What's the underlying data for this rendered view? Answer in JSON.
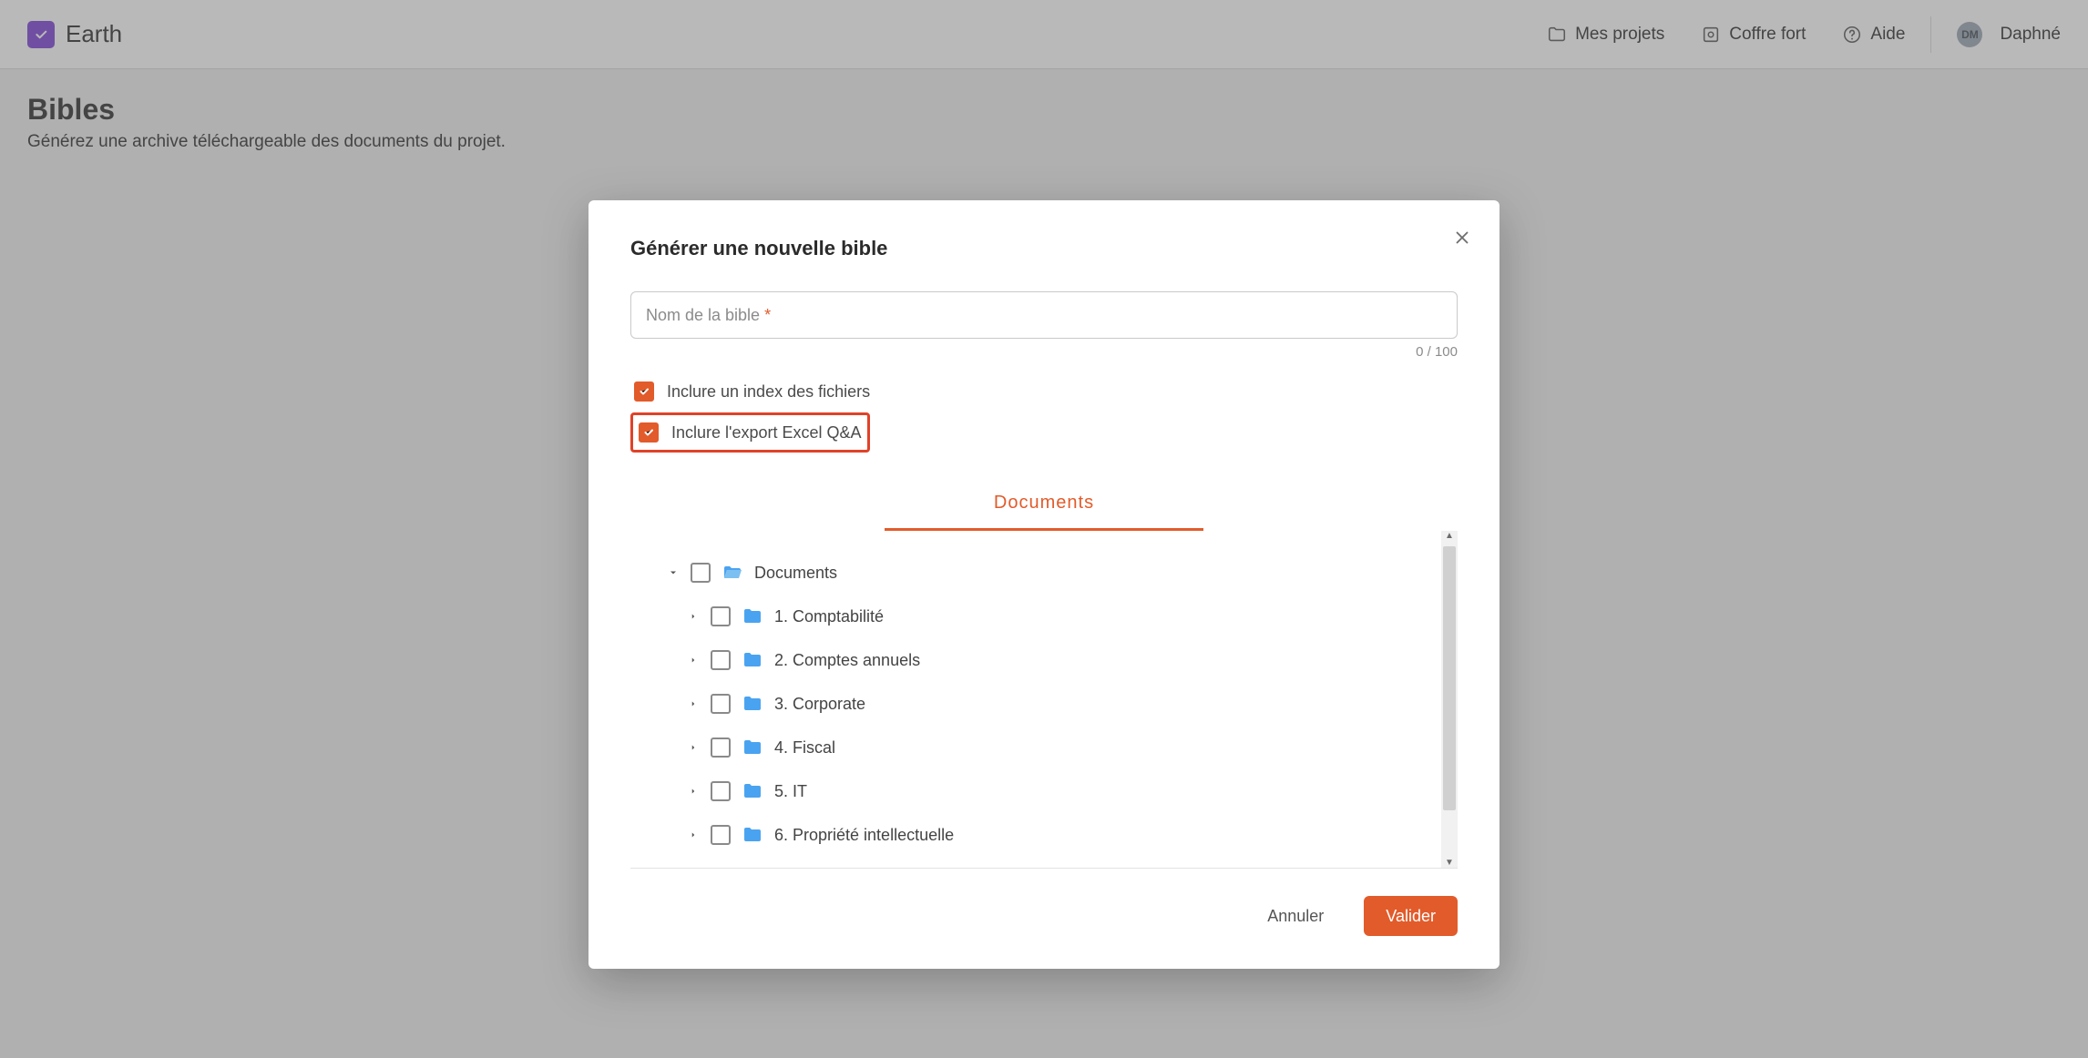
{
  "app": {
    "name": "Earth"
  },
  "header": {
    "nav": [
      {
        "icon": "folder-icon",
        "label": "Mes projets"
      },
      {
        "icon": "vault-icon",
        "label": "Coffre fort"
      },
      {
        "icon": "help-icon",
        "label": "Aide"
      }
    ],
    "user": {
      "initials": "DM",
      "name": "Daphné"
    }
  },
  "page": {
    "title": "Bibles",
    "subtitle": "Générez une archive téléchargeable des documents du projet."
  },
  "modal": {
    "title": "Générer une nouvelle bible",
    "name_field": {
      "label": "Nom de la bible",
      "required_mark": "*",
      "value": ""
    },
    "counter": "0 / 100",
    "checkbox_index": {
      "checked": true,
      "label": "Inclure un index des fichiers"
    },
    "checkbox_qna": {
      "checked": true,
      "label": "Inclure l'export Excel Q&A",
      "highlight": true
    },
    "tab": "Documents",
    "tree": {
      "root": {
        "label": "Documents",
        "expanded": true
      },
      "children": [
        {
          "label": "1. Comptabilité"
        },
        {
          "label": "2. Comptes annuels"
        },
        {
          "label": "3. Corporate"
        },
        {
          "label": "4. Fiscal"
        },
        {
          "label": "5. IT"
        },
        {
          "label": "6. Propriété intellectuelle"
        }
      ]
    },
    "actions": {
      "cancel": "Annuler",
      "confirm": "Valider"
    }
  },
  "colors": {
    "accent": "#e25b2a",
    "purple": "#7a3ed6",
    "folder": "#4aa3f0"
  }
}
